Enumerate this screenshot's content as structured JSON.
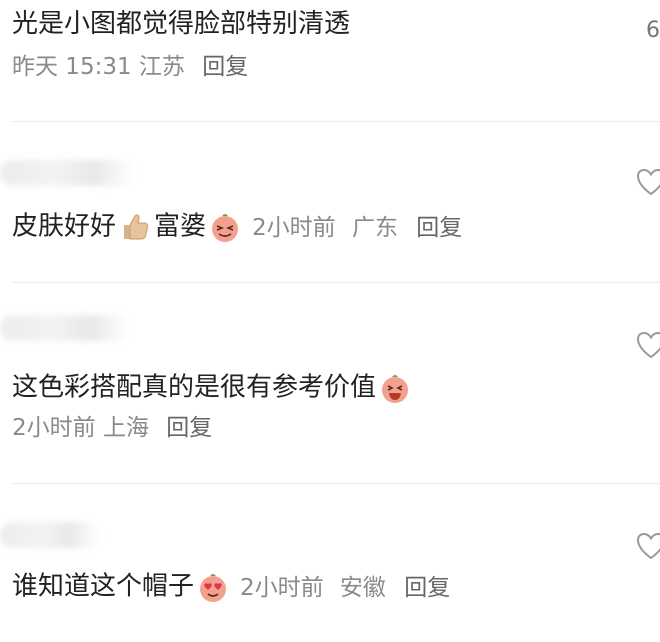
{
  "comments": [
    {
      "text": "光是小图都觉得脸部特别清透",
      "time": "昨天 15:31",
      "location": "江苏",
      "reply": "回复",
      "edge_count": "6"
    },
    {
      "text_a": "皮肤好好",
      "text_b": "富婆",
      "emoji_a": "thumbs-up-icon",
      "emoji_b": "squinting-face-icon",
      "time": "2小时前",
      "location": "广东",
      "reply": "回复"
    },
    {
      "text": "这色彩搭配真的是很有参考价值",
      "emoji": "laughing-face-icon",
      "time": "2小时前",
      "location": "上海",
      "reply": "回复"
    },
    {
      "text": "谁知道这个帽子",
      "emoji": "heart-eyes-face-icon",
      "time": "2小时前",
      "location": "安徽",
      "reply": "回复"
    }
  ],
  "colors": {
    "text": "#222222",
    "meta": "#8a8a8a",
    "divider": "#ececec",
    "emoji": "#f08a7a"
  }
}
